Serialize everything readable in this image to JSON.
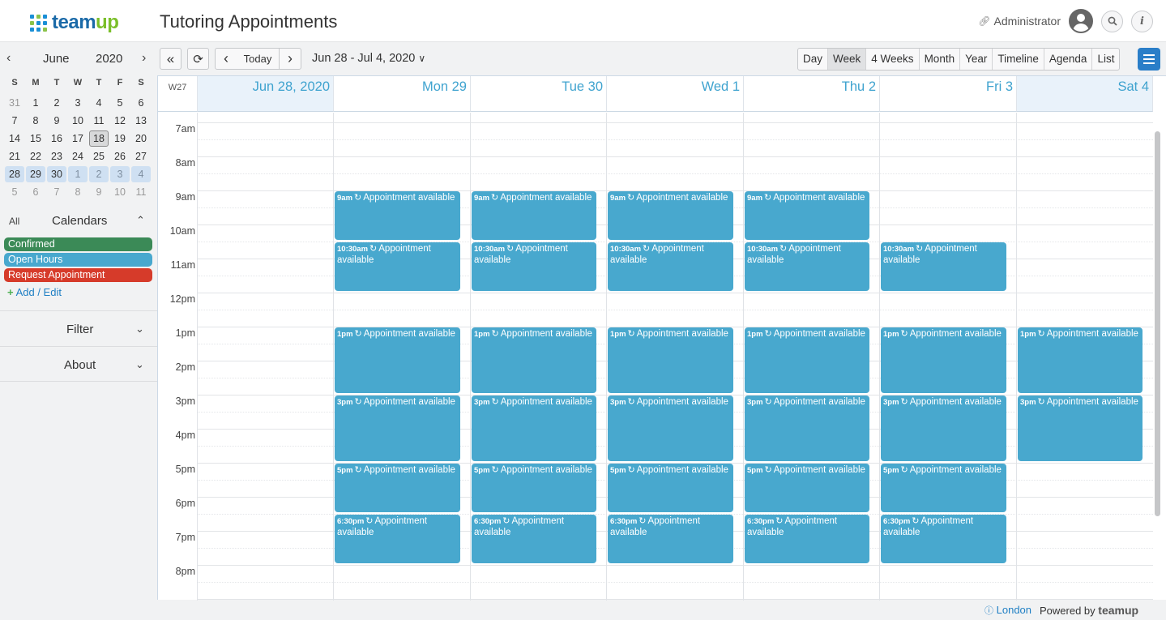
{
  "header": {
    "brand": "teamup",
    "title": "Tutoring Appointments",
    "user": "Administrator"
  },
  "mini_calendar": {
    "month": "June",
    "year": "2020",
    "weekdays": [
      "S",
      "M",
      "T",
      "W",
      "T",
      "F",
      "S"
    ],
    "weeks": [
      [
        "31",
        "1",
        "2",
        "3",
        "4",
        "5",
        "6"
      ],
      [
        "7",
        "8",
        "9",
        "10",
        "11",
        "12",
        "13"
      ],
      [
        "14",
        "15",
        "16",
        "17",
        "18",
        "19",
        "20"
      ],
      [
        "21",
        "22",
        "23",
        "24",
        "25",
        "26",
        "27"
      ],
      [
        "28",
        "29",
        "30",
        "1",
        "2",
        "3",
        "4"
      ],
      [
        "5",
        "6",
        "7",
        "8",
        "9",
        "10",
        "11"
      ]
    ],
    "today": "18"
  },
  "sidebar": {
    "all_label": "All",
    "calendars_title": "Calendars",
    "calendars": [
      {
        "name": "Confirmed",
        "color": "#3b8a57"
      },
      {
        "name": "Open Hours",
        "color": "#48a8ce"
      },
      {
        "name": "Request Appointment",
        "color": "#d63b2a"
      }
    ],
    "add_edit": "Add / Edit",
    "sections": [
      "Filter",
      "About"
    ]
  },
  "toolbar": {
    "today": "Today",
    "date_range": "Jun 28 - Jul 4, 2020",
    "views": [
      "Day",
      "Week",
      "4 Weeks",
      "Month",
      "Year",
      "Timeline",
      "Agenda",
      "List"
    ],
    "active_view": "Week"
  },
  "week": {
    "week_label": "W27",
    "days": [
      "Jun 28, 2020",
      "Mon 29",
      "Tue 30",
      "Wed 1",
      "Thu 2",
      "Fri 3",
      "Sat 4"
    ],
    "hours": [
      "7am",
      "8am",
      "9am",
      "10am",
      "11am",
      "12pm",
      "1pm",
      "2pm",
      "3pm",
      "4pm",
      "5pm",
      "6pm",
      "7pm",
      "8pm"
    ]
  },
  "event_title": "Appointment available",
  "event_color": "#48a8ce",
  "events": [
    {
      "day": 1,
      "time": "9am",
      "start": 9,
      "end": 10.5
    },
    {
      "day": 2,
      "time": "9am",
      "start": 9,
      "end": 10.5
    },
    {
      "day": 3,
      "time": "9am",
      "start": 9,
      "end": 10.5
    },
    {
      "day": 4,
      "time": "9am",
      "start": 9,
      "end": 10.5
    },
    {
      "day": 1,
      "time": "10:30am",
      "start": 10.5,
      "end": 12
    },
    {
      "day": 2,
      "time": "10:30am",
      "start": 10.5,
      "end": 12
    },
    {
      "day": 3,
      "time": "10:30am",
      "start": 10.5,
      "end": 12
    },
    {
      "day": 4,
      "time": "10:30am",
      "start": 10.5,
      "end": 12
    },
    {
      "day": 5,
      "time": "10:30am",
      "start": 10.5,
      "end": 12
    },
    {
      "day": 1,
      "time": "1pm",
      "start": 13,
      "end": 15
    },
    {
      "day": 2,
      "time": "1pm",
      "start": 13,
      "end": 15
    },
    {
      "day": 3,
      "time": "1pm",
      "start": 13,
      "end": 15
    },
    {
      "day": 4,
      "time": "1pm",
      "start": 13,
      "end": 15
    },
    {
      "day": 5,
      "time": "1pm",
      "start": 13,
      "end": 15
    },
    {
      "day": 6,
      "time": "1pm",
      "start": 13,
      "end": 15
    },
    {
      "day": 1,
      "time": "3pm",
      "start": 15,
      "end": 17
    },
    {
      "day": 2,
      "time": "3pm",
      "start": 15,
      "end": 17
    },
    {
      "day": 3,
      "time": "3pm",
      "start": 15,
      "end": 17
    },
    {
      "day": 4,
      "time": "3pm",
      "start": 15,
      "end": 17
    },
    {
      "day": 5,
      "time": "3pm",
      "start": 15,
      "end": 17
    },
    {
      "day": 6,
      "time": "3pm",
      "start": 15,
      "end": 17
    },
    {
      "day": 1,
      "time": "5pm",
      "start": 17,
      "end": 18.5
    },
    {
      "day": 2,
      "time": "5pm",
      "start": 17,
      "end": 18.5
    },
    {
      "day": 3,
      "time": "5pm",
      "start": 17,
      "end": 18.5
    },
    {
      "day": 4,
      "time": "5pm",
      "start": 17,
      "end": 18.5
    },
    {
      "day": 5,
      "time": "5pm",
      "start": 17,
      "end": 18.5
    },
    {
      "day": 1,
      "time": "6:30pm",
      "start": 18.5,
      "end": 20
    },
    {
      "day": 2,
      "time": "6:30pm",
      "start": 18.5,
      "end": 20
    },
    {
      "day": 3,
      "time": "6:30pm",
      "start": 18.5,
      "end": 20
    },
    {
      "day": 4,
      "time": "6:30pm",
      "start": 18.5,
      "end": 20
    },
    {
      "day": 5,
      "time": "6:30pm",
      "start": 18.5,
      "end": 20
    }
  ],
  "footer": {
    "location": "London",
    "powered_by": "Powered by",
    "brand": "teamup"
  }
}
